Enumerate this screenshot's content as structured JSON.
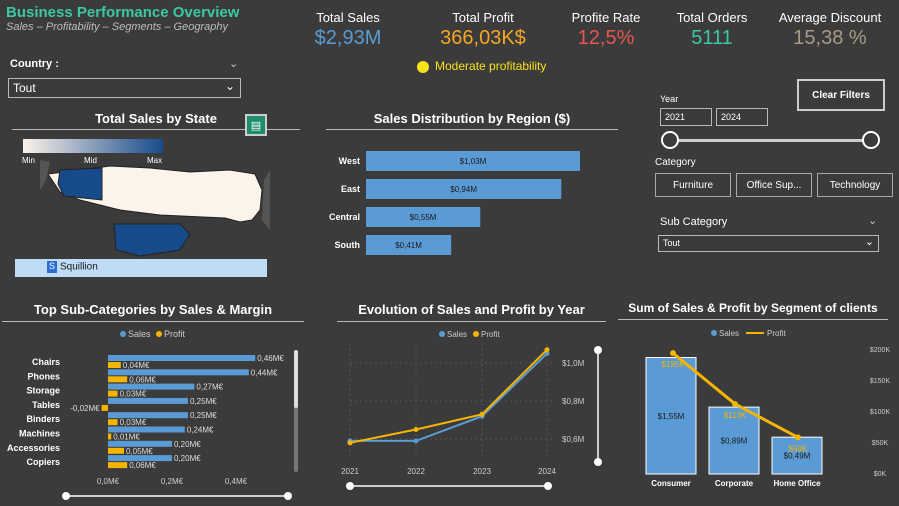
{
  "header": {
    "title": "Business Performance Overview",
    "subtitle": "Sales – Profitability – Segments – Geography"
  },
  "kpis": [
    {
      "label": "Total Sales",
      "value": "$2,93M",
      "color": "#5b9bd5"
    },
    {
      "label": "Total Profit",
      "value": "366,03K$",
      "color": "#f5a623"
    },
    {
      "label": "Profite Rate",
      "value": "12,5%",
      "color": "#e8574e"
    },
    {
      "label": "Total Orders",
      "value": "5111",
      "color": "#3cc7a5"
    },
    {
      "label": "Average Discount",
      "value": "15,38 %",
      "color": "#a89a86"
    }
  ],
  "profitability_note": "Moderate profitability",
  "filters": {
    "country_label": "Country :",
    "country_value": "Tout",
    "year_label": "Year",
    "year_from": "2021",
    "year_to": "2024",
    "clear_label": "Clear Filters",
    "category_label": "Category",
    "categories": [
      "Furniture",
      "Office Sup...",
      "Technology"
    ],
    "subcategory_label": "Sub Category",
    "subcategory_value": "Tout"
  },
  "map": {
    "title": "Total Sales by State",
    "legend": [
      "Min",
      "Mid",
      "Max"
    ],
    "brand": "Squillion"
  },
  "chart_data": [
    {
      "id": "region",
      "type": "bar",
      "orientation": "horizontal",
      "title": "Sales Distribution by Region ($)",
      "categories": [
        "West",
        "East",
        "Central",
        "South"
      ],
      "values": [
        1.03,
        0.94,
        0.55,
        0.41
      ],
      "labels": [
        "$1,03M",
        "$0,94M",
        "$0,55M",
        "$0,41M"
      ],
      "color": "#5b9bd5"
    },
    {
      "id": "subcat",
      "type": "bar",
      "orientation": "horizontal",
      "title": "Top Sub-Categories by Sales & Margin",
      "legend": [
        "Sales",
        "Profit"
      ],
      "categories": [
        "Chairs",
        "Phones",
        "Storage",
        "Tables",
        "Binders",
        "Machines",
        "Accessories",
        "Copiers"
      ],
      "series": [
        {
          "name": "Sales",
          "values": [
            0.46,
            0.44,
            0.27,
            0.25,
            0.25,
            0.24,
            0.2,
            0.2
          ],
          "labels": [
            "0,46M€",
            "0,44M€",
            "0,27M€",
            "0,25M€",
            "0,25M€",
            "0,24M€",
            "0,20M€",
            "0,20M€"
          ],
          "color": "#5b9bd5"
        },
        {
          "name": "Profit",
          "values": [
            0.04,
            0.06,
            0.03,
            -0.02,
            0.03,
            0.01,
            0.05,
            0.06
          ],
          "labels": [
            "0,04M€",
            "0,06M€",
            "0,03M€",
            "-0,02M€",
            "0,03M€",
            "0,01M€",
            "0,05M€",
            "0,06M€"
          ],
          "color": "#f5b400"
        }
      ],
      "xticks": [
        "0,0M€",
        "0,2M€",
        "0,4M€"
      ],
      "xlim": [
        -0.02,
        0.5
      ]
    },
    {
      "id": "evolution",
      "type": "line",
      "title": "Evolution of Sales and Profit by Year",
      "legend": [
        "Sales",
        "Profit"
      ],
      "x": [
        "2021",
        "2022",
        "2023",
        "2024"
      ],
      "series": [
        {
          "name": "Sales",
          "values": [
            0.59,
            0.59,
            0.72,
            1.05
          ],
          "color": "#5b9bd5"
        },
        {
          "name": "Profit",
          "values": [
            0.58,
            0.65,
            0.73,
            1.07
          ],
          "color": "#f5b400"
        }
      ],
      "yticks": [
        "$1,0M",
        "$0,8M",
        "$0,6M"
      ],
      "ylim": [
        0.5,
        1.1
      ]
    },
    {
      "id": "segment",
      "type": "bar",
      "title": "Sum of Sales & Profit by Segment of clients",
      "legend": [
        "Sales",
        "Profit"
      ],
      "categories": [
        "Consumer",
        "Corporate",
        "Home Office"
      ],
      "series": [
        {
          "name": "Sales",
          "values": [
            1.55,
            0.89,
            0.49
          ],
          "labels": [
            "$1,55M",
            "$0,89M",
            "$0,49M"
          ],
          "color": "#5b9bd5"
        },
        {
          "name": "Profit",
          "values": [
            195,
            113,
            59
          ],
          "labels": [
            "$195K",
            "$113K",
            "$59K"
          ],
          "color": "#f5b400"
        }
      ],
      "yticks_right": [
        "$200K",
        "$150K",
        "$100K",
        "$50K",
        "$0K"
      ]
    }
  ]
}
